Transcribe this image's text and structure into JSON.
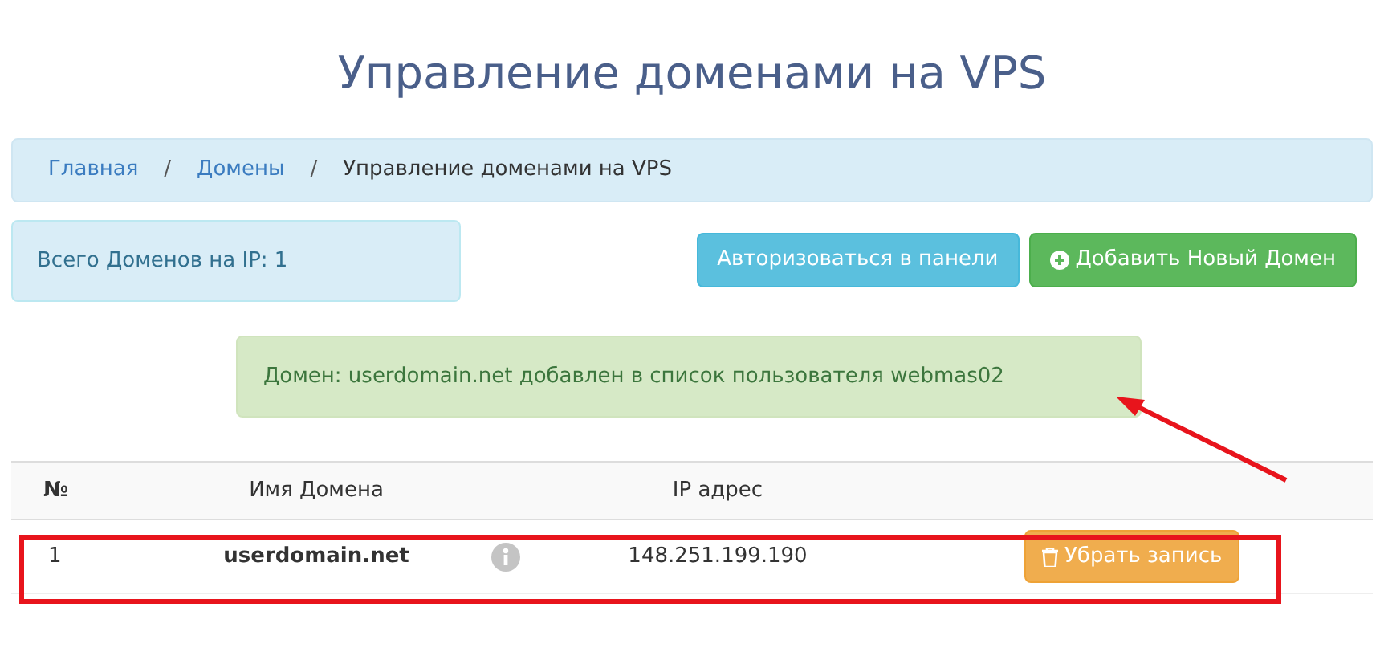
{
  "title": "Управление доменами на VPS",
  "breadcrumb": [
    {
      "label": "Главная",
      "link": true
    },
    {
      "label": "Домены",
      "link": true
    },
    {
      "label": "Управление доменами на VPS",
      "link": false
    }
  ],
  "breadcrumb_separator": "/",
  "summary": "Всего Доменов на IP: 1",
  "buttons": [
    {
      "kind": "info",
      "label": "Авторизоваться в панели"
    },
    {
      "kind": "success",
      "label": "Добавить Новый Домен"
    }
  ],
  "alert": "Домен: userdomain.net добавлен в список пользователя webmas02",
  "table": {
    "columns": [
      "№",
      "Имя Домена",
      "IP адрес"
    ],
    "rows": [
      {
        "number": "1",
        "domain": "userdomain.net",
        "ip": "148.251.199.190",
        "action": "Убрать запись"
      }
    ]
  }
}
